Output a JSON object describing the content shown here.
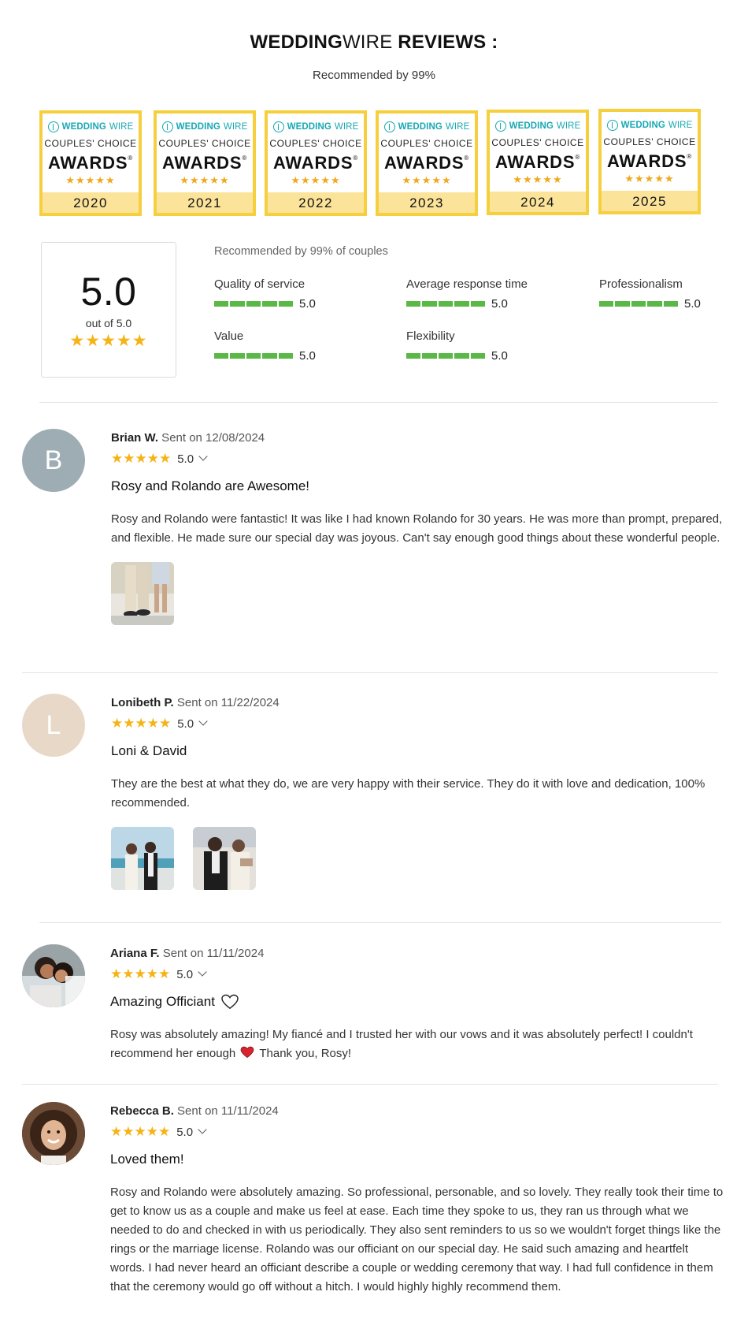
{
  "header": {
    "title_bold": "WEDDING",
    "title_light": "WIRE",
    "title_rest": " REVIEWS :",
    "subtitle": "Recommended by 99%"
  },
  "badges": {
    "brand_bold": "WEDDING",
    "brand_light": "WIRE",
    "line1": "COUPLES' CHOICE",
    "line2": "AWARDS",
    "reg": "®",
    "stars": "★★★★★",
    "years": [
      "2020",
      "2021",
      "2022",
      "2023",
      "2024",
      "2025"
    ]
  },
  "summary": {
    "score": "5.0",
    "out_of": "out of 5.0",
    "stars": "★★★★★",
    "recommended": "Recommended by 99% of couples",
    "metrics": [
      {
        "label": "Quality of service",
        "value": "5.0"
      },
      {
        "label": "Average response time",
        "value": "5.0"
      },
      {
        "label": "Professionalism",
        "value": "5.0"
      },
      {
        "label": "Value",
        "value": "5.0"
      },
      {
        "label": "Flexibility",
        "value": "5.0"
      }
    ]
  },
  "reviews": [
    {
      "initial": "B",
      "avatar_color": "#9eacb3",
      "name": "Brian W.",
      "sent": " Sent on 12/08/2024",
      "stars": "★★★★★",
      "score": "5.0",
      "title": "Rosy and Rolando are Awesome!",
      "text": "Rosy and Rolando were fantastic! It was like I had known Rolando for 30 years. He was more than prompt, prepared, and flexible. He made sure our special day was joyous. Can't say enough good things about these wonderful people."
    },
    {
      "initial": "L",
      "avatar_color": "#e8d8c8",
      "name": "Lonibeth P.",
      "sent": " Sent on 11/22/2024",
      "stars": "★★★★★",
      "score": "5.0",
      "title": "Loni & David",
      "text": "They are the best at what they do, we are very happy with their service. They do it with love and dedication, 100% recommended."
    },
    {
      "initial": "",
      "avatar_color": "#3a3a3a",
      "name": "Ariana F.",
      "sent": " Sent on 11/11/2024",
      "stars": "★★★★★",
      "score": "5.0",
      "title": "Amazing Officiant",
      "text_part1": "Rosy was absolutely amazing! My fiancé and I trusted her with our vows and it was absolutely perfect! I couldn't recommend her enough",
      "text_part2": "Thank you, Rosy!"
    },
    {
      "initial": "",
      "avatar_color": "#5a3a2a",
      "name": "Rebecca B.",
      "sent": " Sent on 11/11/2024",
      "stars": "★★★★★",
      "score": "5.0",
      "title": "Loved them!",
      "text": "Rosy and Rolando were absolutely amazing. So professional, personable, and so lovely. They really took their time to get to know us as a couple and make us feel at ease. Each time they spoke to us, they ran us through what we needed to do and checked in with us periodically. They also sent reminders to us so we wouldn't forget things like the rings or the marriage license. Rolando was our officiant on our special day. He said such amazing and heartfelt words. I had never heard an officiant describe a couple or wedding ceremony that way. I had full confidence in them that the ceremony would go off without a hitch. I would highly highly recommend them."
    }
  ],
  "colors": {
    "badge_border": "#f6cf3e",
    "badge_year_band": "#fbe49a",
    "brand_teal": "#18a8b4",
    "star_gold": "#f5b315",
    "bar_green": "#5ab846"
  }
}
